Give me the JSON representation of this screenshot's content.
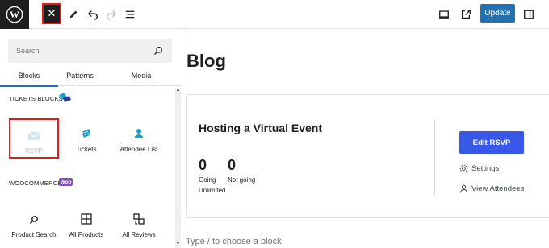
{
  "toolbar": {
    "logo_icon": "wordpress-logo-icon",
    "close_symbol": "✕",
    "close_icon": "close-icon",
    "tools_icon": "pencil-icon",
    "undo_icon": "undo-icon",
    "redo_icon": "redo-icon",
    "list_view_icon": "list-view-icon",
    "preview_icon": "desktop-icon",
    "view_post_icon": "external-link-icon",
    "update_label": "Update",
    "settings_icon": "sidebar-toggle-icon"
  },
  "inserter": {
    "search": {
      "placeholder": "Search",
      "value": ""
    },
    "tabs": [
      {
        "label": "Blocks",
        "active": true
      },
      {
        "label": "Patterns",
        "active": false
      },
      {
        "label": "Media",
        "active": false
      }
    ],
    "sections": [
      {
        "title": "TICKETS BLOCKS",
        "icon": "tickets-logo-icon",
        "items": [
          {
            "label": "RSVP",
            "icon": "envelope-icon",
            "disabled": true
          },
          {
            "label": "Tickets",
            "icon": "ticket-icon",
            "disabled": false
          },
          {
            "label": "Attendee List",
            "icon": "person-icon",
            "disabled": false
          }
        ]
      },
      {
        "title": "WOOCOMMERCE",
        "badge": "Woo",
        "items": [
          {
            "label": "Product Search",
            "icon": "search-icon",
            "disabled": false
          },
          {
            "label": "All Products",
            "icon": "grid-icon",
            "disabled": false
          },
          {
            "label": "All Reviews",
            "icon": "reviews-icon",
            "disabled": false
          }
        ]
      }
    ]
  },
  "editor": {
    "page_title": "Blog",
    "rsvp": {
      "event_title": "Hosting a Virtual Event",
      "going_count": "0",
      "going_label": "Going",
      "not_going_count": "0",
      "not_going_label": "Not going",
      "limit_label": "Unlimited",
      "edit_button": "Edit RSVP",
      "settings_label": "Settings",
      "attendees_label": "View Attendees"
    },
    "appender_hint": "Type / to choose a block"
  },
  "colors": {
    "accent_blue": "#2271b1",
    "rsvp_button": "#3858e9",
    "highlight_red": "#e01b1b",
    "tickets_cyan": "#1aa0c8",
    "woo_purple": "#7f54b3"
  }
}
